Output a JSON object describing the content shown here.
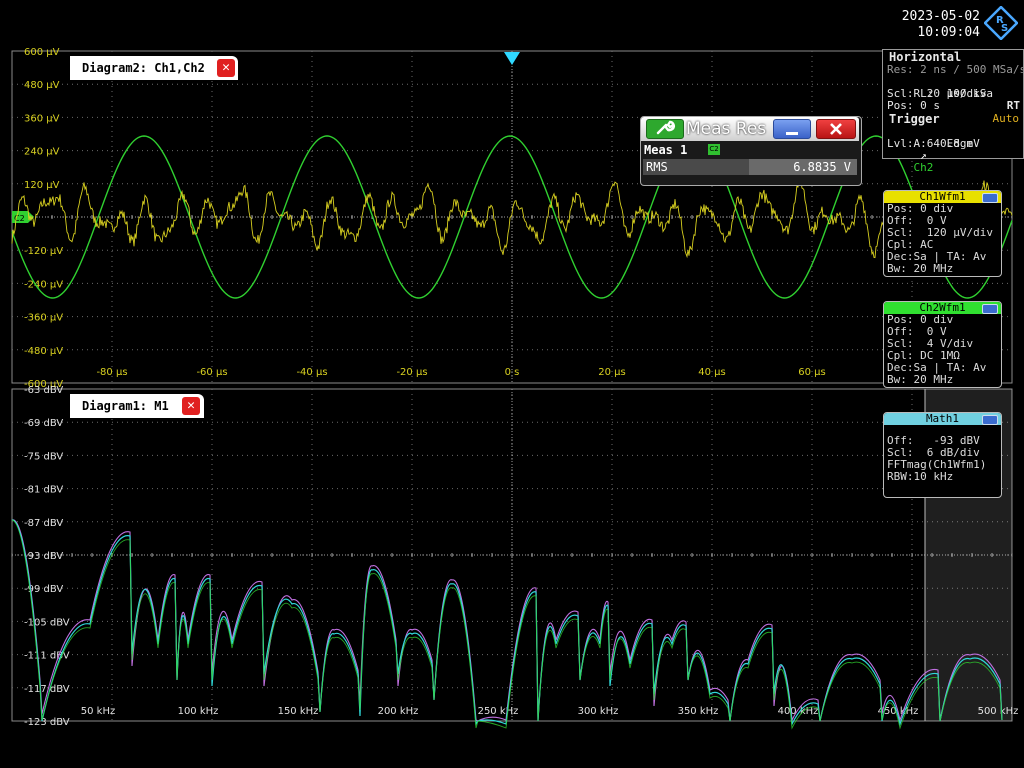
{
  "datetime": {
    "date": "2023-05-02",
    "time": "10:09:04"
  },
  "logo": {
    "icon": "rohde-schwarz-logo-icon"
  },
  "diagram2": {
    "title": "Diagram2: Ch1,Ch2",
    "y_labels": [
      "600 µV",
      "480 µV",
      "360 µV",
      "240 µV",
      "120 µV",
      "",
      "-120 µV",
      "-240 µV",
      "-360 µV",
      "-480 µV",
      "-600 µV"
    ],
    "x_labels": [
      "-80 µs",
      "-60 µs",
      "-40 µs",
      "-20 µs",
      "0 s",
      "20 µs",
      "40 µs",
      "60 µs"
    ],
    "ch2_marker": "C2"
  },
  "diagram1": {
    "title": "Diagram1: M1",
    "y_labels": [
      "-63 dBV",
      "-69 dBV",
      "-75 dBV",
      "-81 dBV",
      "-87 dBV",
      "-93 dBV",
      "-99 dBV",
      "-105 dBV",
      "-111 dBV",
      "-117 dBV",
      "-123 dBV"
    ],
    "x_labels": [
      "50 kHz",
      "100 kHz",
      "150 kHz",
      "200 kHz",
      "250 kHz",
      "300 kHz",
      "350 kHz",
      "400 kHz",
      "450 kHz",
      "500 kHz"
    ]
  },
  "horizontal": {
    "title": "Horizontal",
    "res": "Res: 2 ns / 500 MSa/s",
    "rl": "RL:  100 kSa",
    "rt": "RT",
    "scl": "Scl:  20 µs/div",
    "pos": "Pos: 0 s"
  },
  "trigger": {
    "title": "Trigger",
    "mode": "Auto",
    "source_prefix": "A:   Edge",
    "source": "Ch2",
    "level": "Lvl:  640.8 mV"
  },
  "ch1": {
    "title": "Ch1Wfm1",
    "lines": [
      "Pos: 0 div",
      "Off:  0 V",
      "Scl:  120 µV/div",
      "Cpl: AC",
      "Dec:Sa | TA: Av",
      "Bw: 20 MHz"
    ]
  },
  "ch2": {
    "title": "Ch2Wfm1",
    "lines": [
      "Pos: 0 div",
      "Off:  0 V",
      "Scl:  4 V/div",
      "Cpl: DC 1MΩ",
      "Dec:Sa | TA: Av",
      "Bw: 20 MHz"
    ]
  },
  "math1": {
    "title": "Math1",
    "lines": [
      "Off:   -93 dBV",
      "Scl:  6 dB/div",
      "FFTmag(Ch1Wfm1)",
      "RBW:10 kHz"
    ]
  },
  "meas": {
    "title": "Meas Res",
    "name": "Meas 1",
    "badge": "C2",
    "param": "RMS",
    "value": "6.8835 V"
  },
  "colors": {
    "ch1": "#d8d020",
    "ch2": "#30d030",
    "math_cyan": "#30d8d8",
    "math_violet": "#c070e0",
    "grid": "#6a6a6a"
  }
}
